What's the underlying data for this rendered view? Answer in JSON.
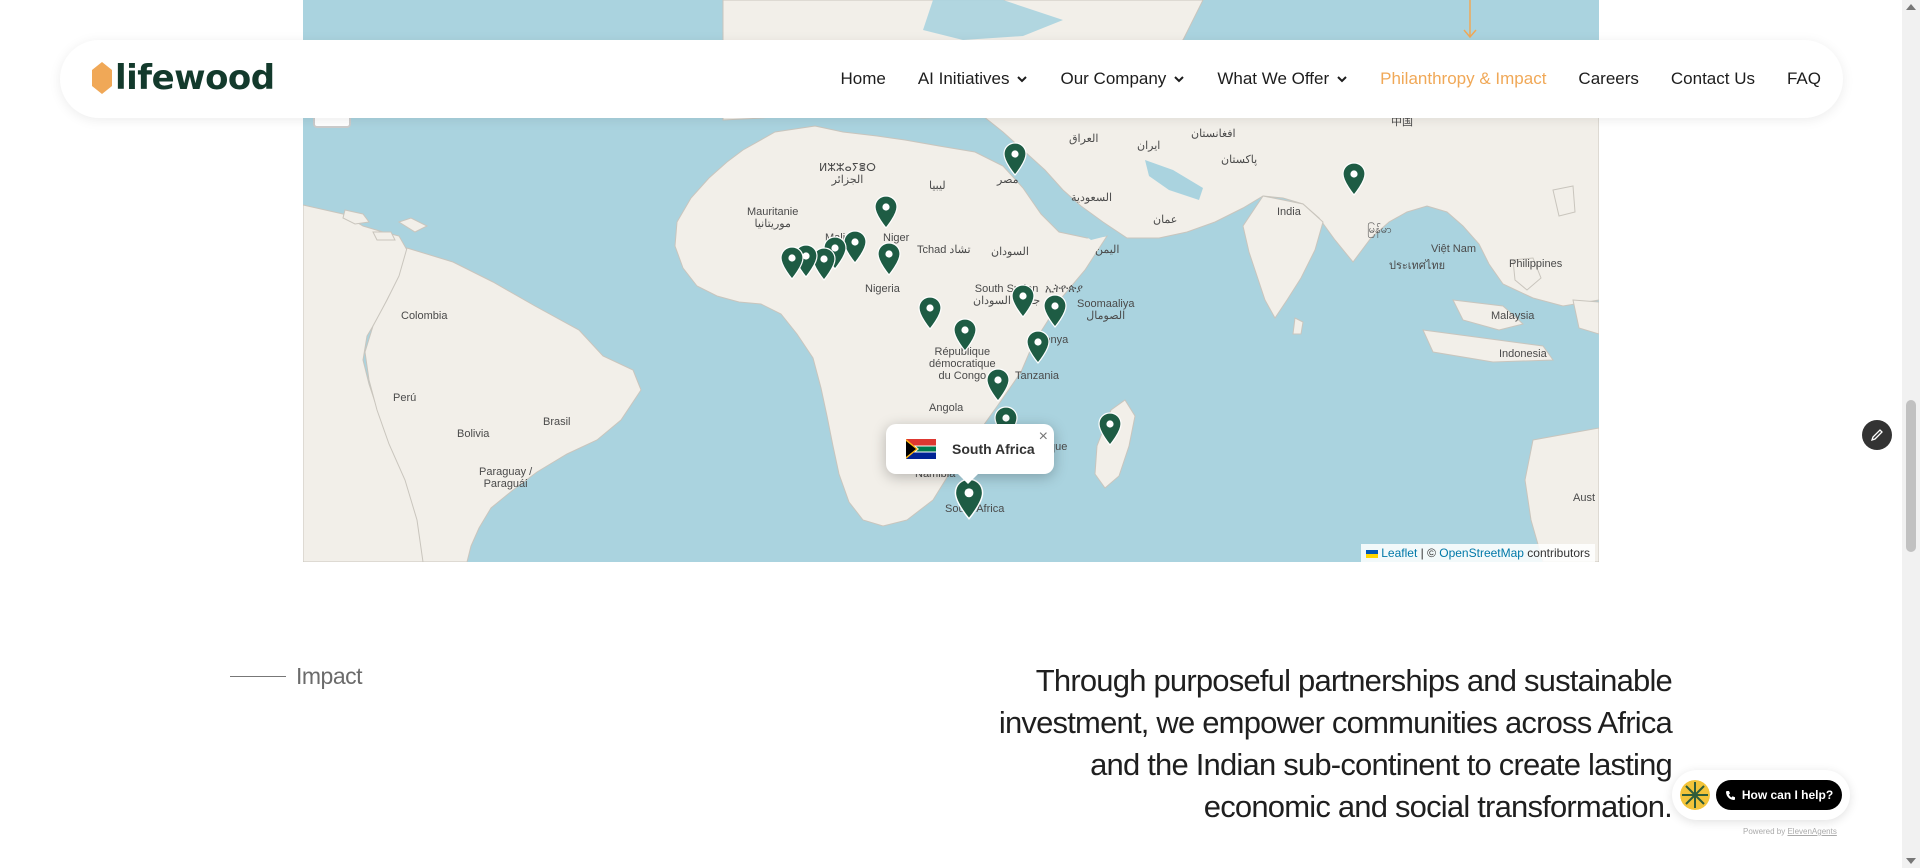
{
  "brand": {
    "name": "lifewood",
    "logo_color": "#f0a857",
    "text_color": "#133a2c"
  },
  "nav": {
    "items": [
      {
        "label": "Home",
        "dropdown": false,
        "active": false
      },
      {
        "label": "AI Initiatives",
        "dropdown": true,
        "active": false
      },
      {
        "label": "Our Company",
        "dropdown": true,
        "active": false
      },
      {
        "label": "What We Offer",
        "dropdown": true,
        "active": false
      },
      {
        "label": "Philanthropy & Impact",
        "dropdown": false,
        "active": true
      },
      {
        "label": "Careers",
        "dropdown": false,
        "active": false
      },
      {
        "label": "Contact Us",
        "dropdown": false,
        "active": false
      },
      {
        "label": "FAQ",
        "dropdown": false,
        "active": false
      }
    ],
    "active_color": "#f0a857"
  },
  "map": {
    "labels": {
      "afghanistan": "افغانستان",
      "iraq": "العراق",
      "iran": "ایران",
      "china": "中国",
      "pakistan": "پاکستان",
      "algeria": "ⵍⵣⵣⴰⵢⴻⵔ\nالجزائر",
      "libya": "ليبيا",
      "egypt": "مصر",
      "saudi": "السعودية",
      "oman": "عمان",
      "india": "India",
      "myanmar": "မြန်မာ",
      "mauritania": "Mauritanie\nموريتانيا",
      "mali": "Mali",
      "niger": "Niger",
      "chad": "Tchad تشاد",
      "sudan": "السودان",
      "yemen": "اليمن",
      "vietnam": "Việt Nam",
      "philippines": "Philippines",
      "thailand": "ประเทศไทย",
      "nigeria": "Nigeria",
      "south_sudan": "South Sudan\nجنوب السودان",
      "ethiopia": "ኢትዮጵያ",
      "somalia": "Soomaaliya\nالصومال",
      "colombia": "Colombia",
      "malaysia": "Malaysia",
      "kenya": "Kenya",
      "drc": "République\ndémocratique\ndu Congo",
      "tanzania": "Tanzania",
      "indonesia": "Indonesia",
      "peru": "Perú",
      "brasil": "Brasil",
      "bolivia": "Bolivia",
      "angola": "Angola",
      "mozambique": "que",
      "paraguay": "Paraguay /\nParaguái",
      "namibia": "Namibia",
      "south_africa": "South Africa",
      "australia": "Aust"
    },
    "popup": {
      "country": "South Africa",
      "close": "×"
    },
    "attribution": {
      "leaflet": "Leaflet",
      "separator": " | © ",
      "osm": "OpenStreetMap",
      "suffix": " contributors"
    },
    "pin_color": "#1e5c44"
  },
  "impact": {
    "label": "Impact",
    "text": "Through purposeful partnerships and sustainable investment, we empower communities across Africa and the Indian sub-continent to create lasting economic and social transformation."
  },
  "help_widget": {
    "button_label": "How can I help?",
    "powered_prefix": "Powered by ",
    "powered_brand": "ElevenAgents"
  }
}
